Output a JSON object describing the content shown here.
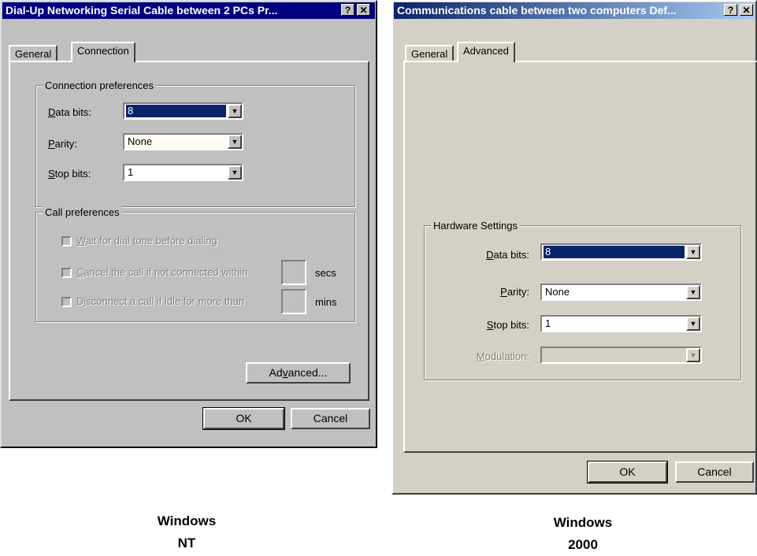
{
  "nt": {
    "title": "Dial-Up Networking Serial Cable between 2 PCs Pr...",
    "help_glyph": "?",
    "close_glyph": "✕",
    "tabs": [
      "General",
      "Connection"
    ],
    "connection_prefs": {
      "legend": "Connection preferences",
      "data_bits_label_key": "D",
      "data_bits_label_rest": "ata bits:",
      "data_bits_value": "8",
      "parity_label_key": "P",
      "parity_label_rest": "arity:",
      "parity_value": "None",
      "stop_bits_label_key": "S",
      "stop_bits_label_rest": "top bits:",
      "stop_bits_value": "1"
    },
    "call_prefs": {
      "legend": "Call preferences",
      "wait_dial_key": "W",
      "wait_dial_rest": "ait for dial tone before dialing",
      "cancel_key": "C",
      "cancel_rest": "ancel the call if not connected within",
      "cancel_unit": "secs",
      "disconnect_pre": "D",
      "disconnect_key": "i",
      "disconnect_rest": "sconnect a call if idle for more than",
      "disconnect_unit": "mins"
    },
    "advanced_pre": "Ad",
    "advanced_key": "v",
    "advanced_rest": "anced...",
    "ok_label": "OK",
    "cancel_label": "Cancel",
    "caption_line1": "Windows",
    "caption_line2": "NT"
  },
  "w2k": {
    "title": "Communications cable between two computers Def...",
    "help_glyph": "?",
    "close_glyph": "✕",
    "tabs": [
      "General",
      "Advanced"
    ],
    "hardware": {
      "legend": "Hardware Settings",
      "data_bits_key": "D",
      "data_bits_rest": "ata bits:",
      "data_bits_value": "8",
      "parity_key": "P",
      "parity_rest": "arity:",
      "parity_value": "None",
      "stop_bits_key": "S",
      "stop_bits_rest": "top bits:",
      "stop_bits_value": "1",
      "modulation_key": "M",
      "modulation_rest": "odulation:",
      "modulation_value": ""
    },
    "ok_label": "OK",
    "cancel_label": "Cancel",
    "caption_line1": "Windows",
    "caption_line2": "2000"
  },
  "icons": {
    "dropdown": "▼"
  }
}
